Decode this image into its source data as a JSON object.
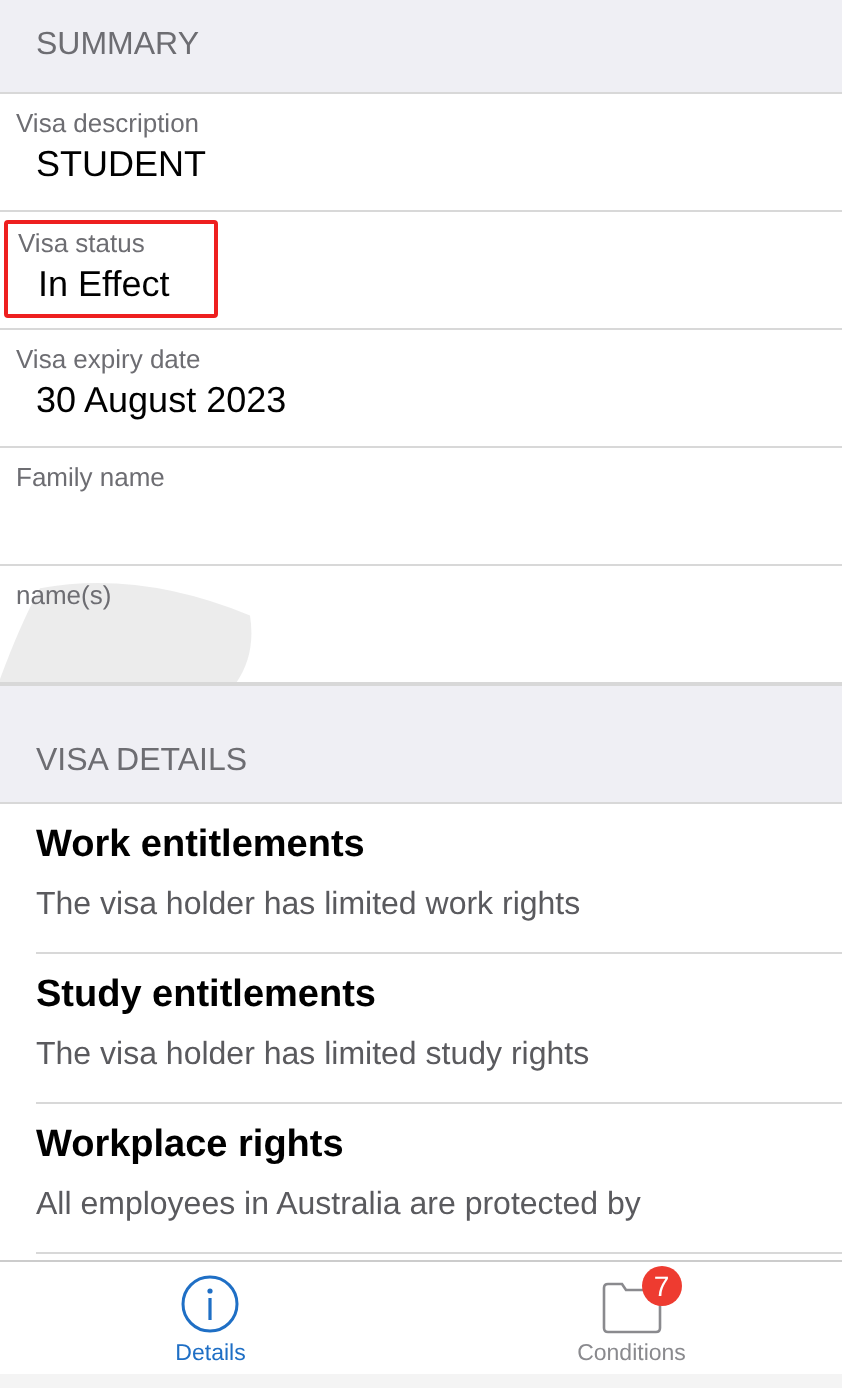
{
  "summary": {
    "heading": "SUMMARY",
    "fields": [
      {
        "label": "Visa description",
        "value": "STUDENT",
        "highlighted": false
      },
      {
        "label": "Visa status",
        "value": "In Effect",
        "highlighted": true
      },
      {
        "label": "Visa expiry date",
        "value": "30 August 2023",
        "highlighted": false
      },
      {
        "label": "Family name",
        "highlighted": false
      },
      {
        "label": "name(s)",
        "highlighted": false
      }
    ]
  },
  "visa_details": {
    "heading": "VISA DETAILS",
    "items": [
      {
        "title": "Work entitlements",
        "description": "The visa holder has limited work rights"
      },
      {
        "title": "Study entitlements",
        "description": "The visa holder has limited study rights"
      },
      {
        "title": "Workplace rights",
        "description": "All employees in Australia are protected by"
      }
    ]
  },
  "tab_bar": [
    {
      "label": "Details",
      "selected": true
    },
    {
      "label": "Conditions",
      "selected": false,
      "badge": "7"
    }
  ]
}
